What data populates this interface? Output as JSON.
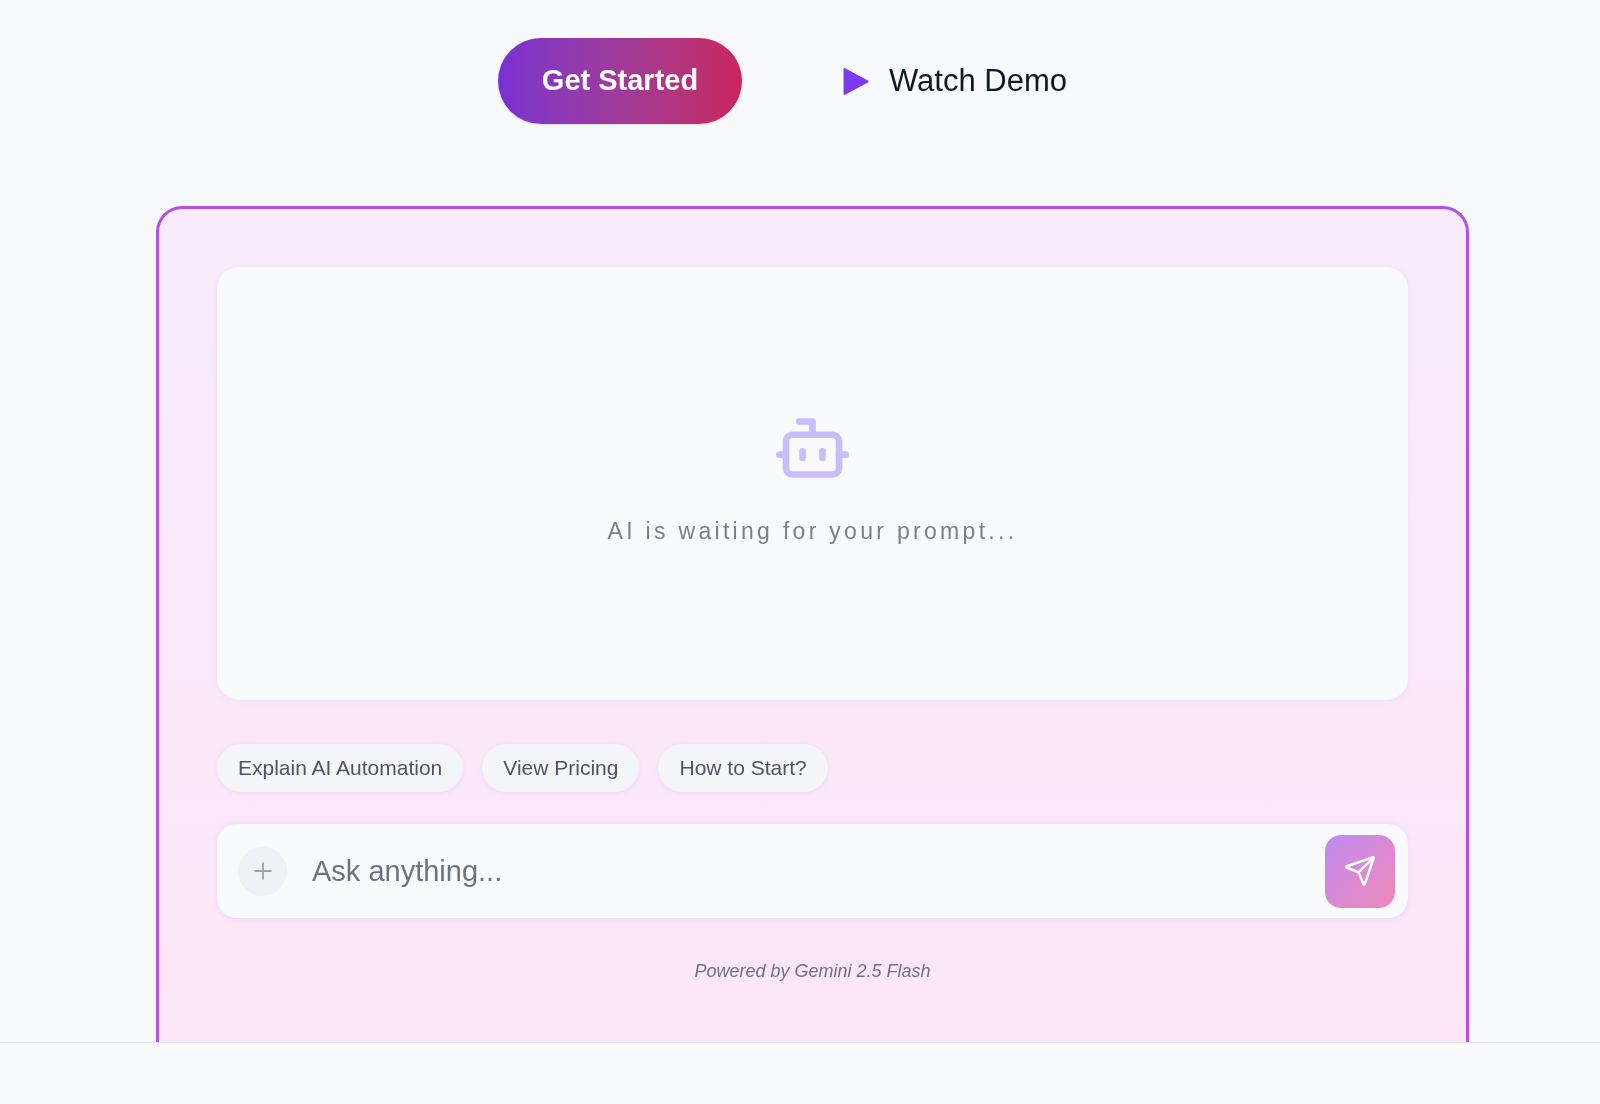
{
  "hero_actions": [
    {
      "kind": "primary",
      "label": "Get Started"
    },
    {
      "kind": "video",
      "label": "Watch Demo"
    }
  ],
  "chat": {
    "status_text": "AI is waiting for your prompt...",
    "suggestions": [
      "Explain AI Automation",
      "View Pricing",
      "How to Start?"
    ],
    "input": {
      "placeholder": "Ask anything..."
    },
    "send_button": {
      "disabled": true
    },
    "footer": "Powered by Gemini 2.5 Flash"
  }
}
